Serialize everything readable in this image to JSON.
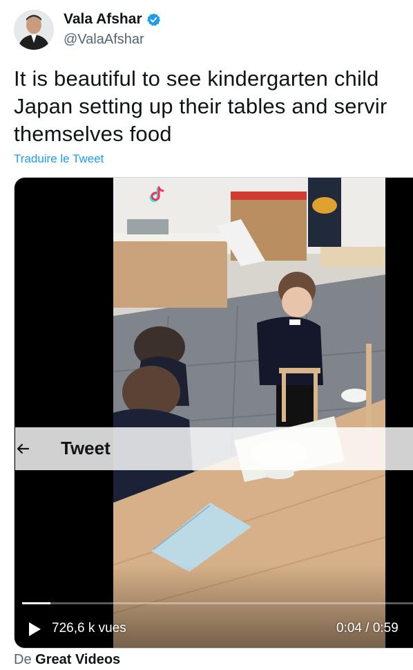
{
  "author": {
    "name": "Vala Afshar",
    "handle": "@ValaAfshar",
    "verified_color": "#1d9bf0"
  },
  "tweet": {
    "text_lines": [
      "It is beautiful to see kindergarten child",
      "Japan setting up their tables and servir",
      "themselves food"
    ],
    "translate_label": "Traduire le Tweet"
  },
  "video": {
    "views": "726,6 k vues",
    "time": "0:04 / 0:59",
    "progress": 0.068
  },
  "appbar": {
    "title": "Tweet"
  },
  "source": {
    "prefix": "De",
    "name": "Great Videos"
  },
  "icons": [
    "verified-badge-icon",
    "play-icon",
    "back-arrow-icon",
    "tiktok-logo-icon"
  ],
  "colors": {
    "link": "#1d9bf0",
    "secondary_text": "#536471"
  }
}
